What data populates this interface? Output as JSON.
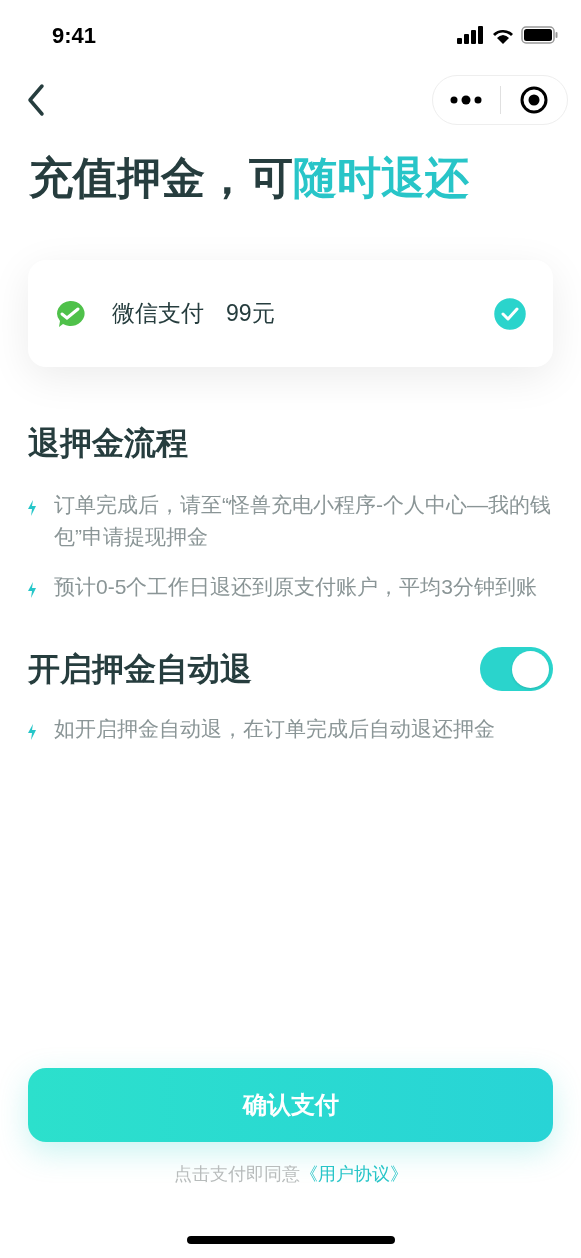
{
  "status_bar": {
    "time": "9:41"
  },
  "title": {
    "lead": "充值押金，可",
    "highlight": "随时退还"
  },
  "payment": {
    "method": "微信支付",
    "amount": "99元",
    "selected": true
  },
  "refund_process": {
    "heading": "退押金流程",
    "items": [
      "订单完成后，请至“怪兽充电小程序-个人中心—我的钱包”申请提现押金",
      "预计0-5个工作日退还到原支付账户，平均3分钟到账"
    ]
  },
  "auto_refund": {
    "heading": "开启押金自动退",
    "on": true,
    "items": [
      "如开启押金自动退，在订单完成后自动退还押金"
    ]
  },
  "confirm_button": "确认支付",
  "agreement": {
    "text": "点击支付即同意",
    "link": "《用户协议》"
  }
}
